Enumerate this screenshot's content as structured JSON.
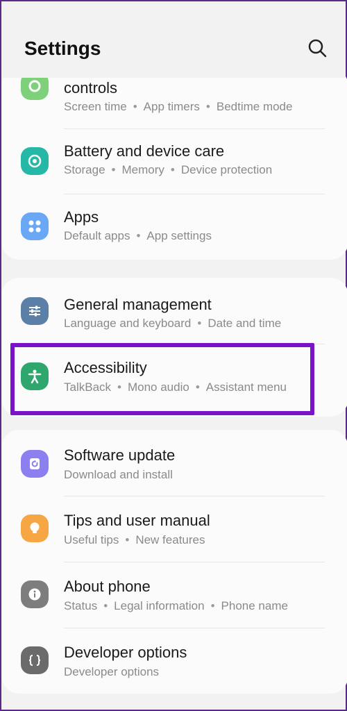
{
  "header": {
    "title": "Settings"
  },
  "group1": [
    {
      "title": "controls",
      "sub": [
        "Screen time",
        "App timers",
        "Bedtime mode"
      ],
      "icon": "digital-wellbeing-icon",
      "color": "#7ed07a"
    },
    {
      "title": "Battery and device care",
      "sub": [
        "Storage",
        "Memory",
        "Device protection"
      ],
      "icon": "device-care-icon",
      "color": "#26b8a6"
    },
    {
      "title": "Apps",
      "sub": [
        "Default apps",
        "App settings"
      ],
      "icon": "apps-icon",
      "color": "#6aa7f5"
    }
  ],
  "group2": [
    {
      "title": "General management",
      "sub": [
        "Language and keyboard",
        "Date and time"
      ],
      "icon": "general-management-icon",
      "color": "#5b7fa6"
    },
    {
      "title": "Accessibility",
      "sub": [
        "TalkBack",
        "Mono audio",
        "Assistant menu"
      ],
      "icon": "accessibility-icon",
      "color": "#2fa66d"
    }
  ],
  "group3": [
    {
      "title": "Software update",
      "sub": [
        "Download and install"
      ],
      "icon": "software-update-icon",
      "color": "#8c7ff0"
    },
    {
      "title": "Tips and user manual",
      "sub": [
        "Useful tips",
        "New features"
      ],
      "icon": "tips-icon",
      "color": "#f6a744"
    },
    {
      "title": "About phone",
      "sub": [
        "Status",
        "Legal information",
        "Phone name"
      ],
      "icon": "info-icon",
      "color": "#7d7d7d"
    },
    {
      "title": "Developer options",
      "sub": [
        "Developer options"
      ],
      "icon": "developer-options-icon",
      "color": "#6b6b6b"
    }
  ],
  "highlight_color": "#7a12c9"
}
